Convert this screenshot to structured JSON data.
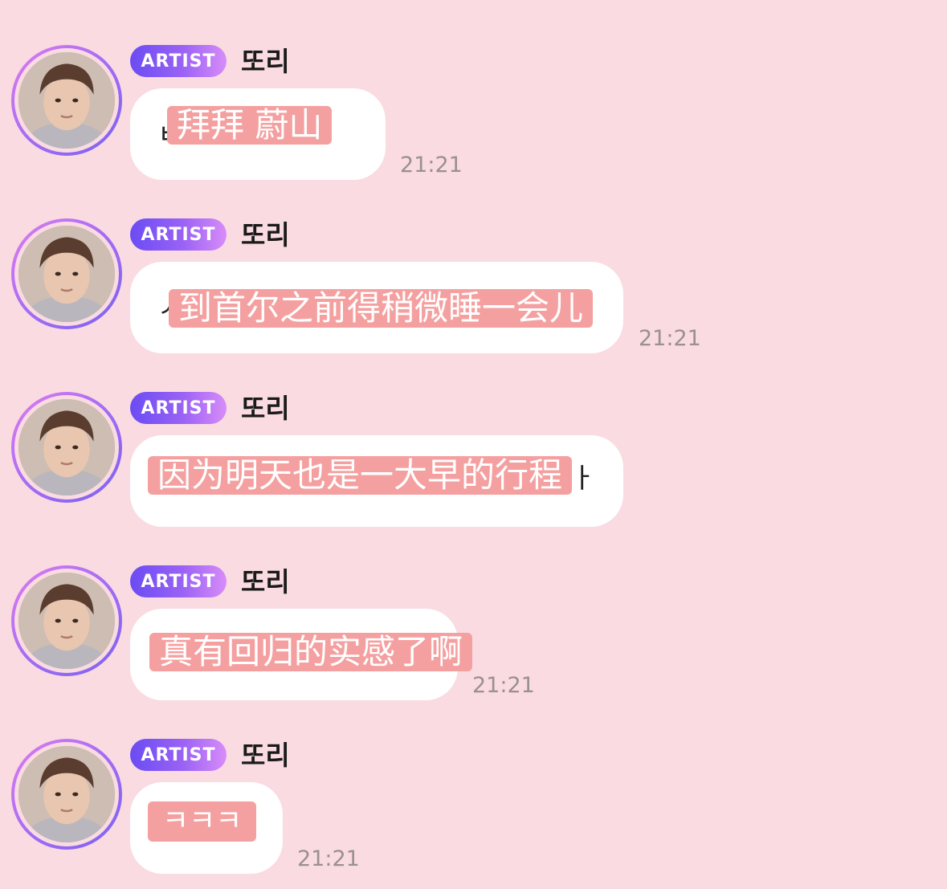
{
  "messages": [
    {
      "badge": "ARTIST",
      "sender": "또리",
      "text": "拜拜 蔚山",
      "time": "21:21"
    },
    {
      "badge": "ARTIST",
      "sender": "또리",
      "text": "到首尔之前得稍微睡一会儿",
      "time": "21:21"
    },
    {
      "badge": "ARTIST",
      "sender": "또리",
      "text": "因为明天也是一大早的行程",
      "time": ""
    },
    {
      "badge": "ARTIST",
      "sender": "또리",
      "text": "真有回归的实感了啊",
      "time": "21:21"
    },
    {
      "badge": "ARTIST",
      "sender": "또리",
      "text": "ㅋㅋㅋ",
      "time": "21:21"
    }
  ],
  "colors": {
    "background": "#f9dbe1",
    "badge_gradient_start": "#6a4cf3",
    "badge_gradient_end": "#d78cf8",
    "highlight": "#f5a0a0",
    "bubble": "#ffffff",
    "time": "#9a8f92"
  }
}
